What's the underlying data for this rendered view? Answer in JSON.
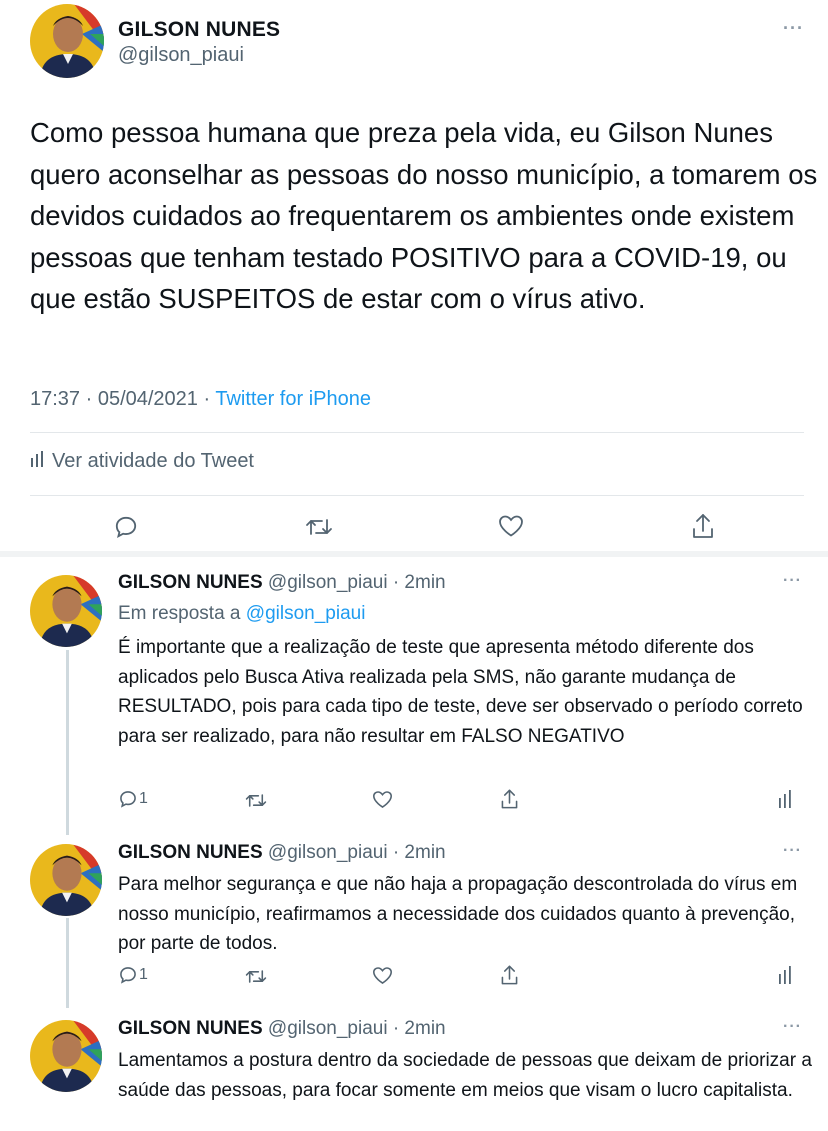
{
  "main_tweet": {
    "name": "GILSON NUNES",
    "handle": "@gilson_piaui",
    "more": "···",
    "text": "Como pessoa humana que preza pela vida, eu Gilson Nunes quero aconselhar as pessoas do nosso município, a tomarem os devidos cuidados ao frequentarem os ambientes onde existem pessoas que tenham testado POSITIVO para a COVID-19, ou que estão SUSPEITOS de estar com o vírus ativo.",
    "time": "17:37 · 05/04/2021 ·",
    "source": "Twitter for iPhone",
    "activity_label": "Ver atividade do Tweet",
    "actions": [
      "reply-icon",
      "retweet-icon",
      "like-icon",
      "share-icon"
    ]
  },
  "replies": [
    {
      "name": "GILSON NUNES",
      "handle_time": "@gilson_piaui · 2min",
      "reply_prefix": "Em resposta a",
      "reply_to": "@gilson_piaui",
      "text": "É importante que a realização de teste que apresenta método diferente dos aplicados pelo Busca Ativa realizada pela SMS, não garante mudança de RESULTADO, pois para cada tipo de teste, deve ser observado o período correto para ser realizado, para não resultar em FALSO NEGATIVO",
      "reply_count": "1",
      "more": "···"
    },
    {
      "name": "GILSON NUNES",
      "handle_time": "@gilson_piaui · 2min",
      "text": "Para melhor segurança e que não haja a propagação descontrolada do vírus em nosso município, reafirmamos a necessidade dos cuidados quanto à prevenção, por parte de todos.",
      "reply_count": "1",
      "more": "···"
    },
    {
      "name": "GILSON NUNES",
      "handle_time": "@gilson_piaui · 2min",
      "text": "Lamentamos a postura dentro da sociedade de pessoas que deixam de priorizar a saúde das pessoas, para focar somente em meios que visam o lucro capitalista.",
      "more": "···"
    }
  ],
  "colors": {
    "link": "#1d9bf0",
    "secondary_text": "#536471",
    "primary_text": "#0f1419",
    "divider": "#e3e7ea"
  }
}
